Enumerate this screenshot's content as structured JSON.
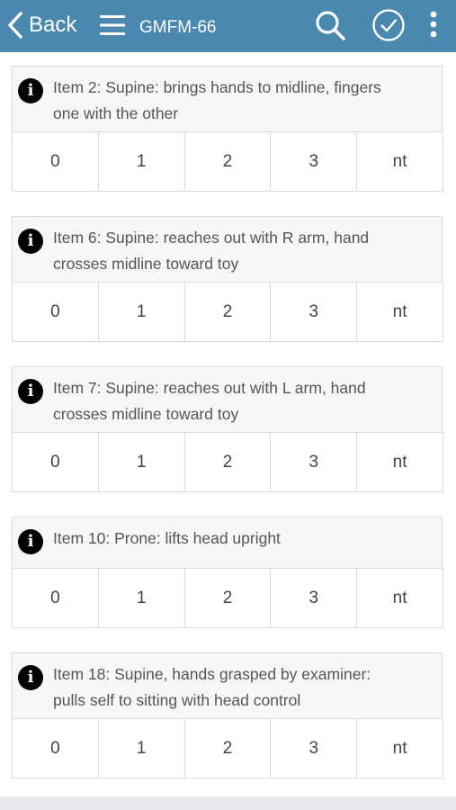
{
  "navbar": {
    "back_label": "Back",
    "title": "GMFM-66",
    "back_icon": "chevron-left-icon",
    "menu_icon": "hamburger-menu-icon",
    "search_icon": "search-icon",
    "check_icon": "check-circle-icon",
    "more_icon": "vertical-ellipsis-icon",
    "bar_color": "#4a88b0"
  },
  "score_options": [
    "0",
    "1",
    "2",
    "3",
    "nt"
  ],
  "items": [
    {
      "lines": [
        "Item 2: Supine: brings hands to midline, fingers",
        "one with the other"
      ],
      "scores": [
        "0",
        "1",
        "2",
        "3",
        "nt"
      ]
    },
    {
      "lines": [
        "Item 6: Supine: reaches out with R arm, hand",
        "crosses midline toward toy"
      ],
      "scores": [
        "0",
        "1",
        "2",
        "3",
        "nt"
      ]
    },
    {
      "lines": [
        "Item 7: Supine: reaches out with L arm, hand",
        "crosses midline toward toy"
      ],
      "scores": [
        "0",
        "1",
        "2",
        "3",
        "nt"
      ]
    },
    {
      "lines": [
        "Item 10: Prone: lifts head upright"
      ],
      "scores": [
        "0",
        "1",
        "2",
        "3",
        "nt"
      ]
    },
    {
      "lines": [
        "Item 18: Supine, hands grasped by examiner:",
        "pulls self to sitting with head control"
      ],
      "scores": [
        "0",
        "1",
        "2",
        "3",
        "nt"
      ]
    }
  ]
}
